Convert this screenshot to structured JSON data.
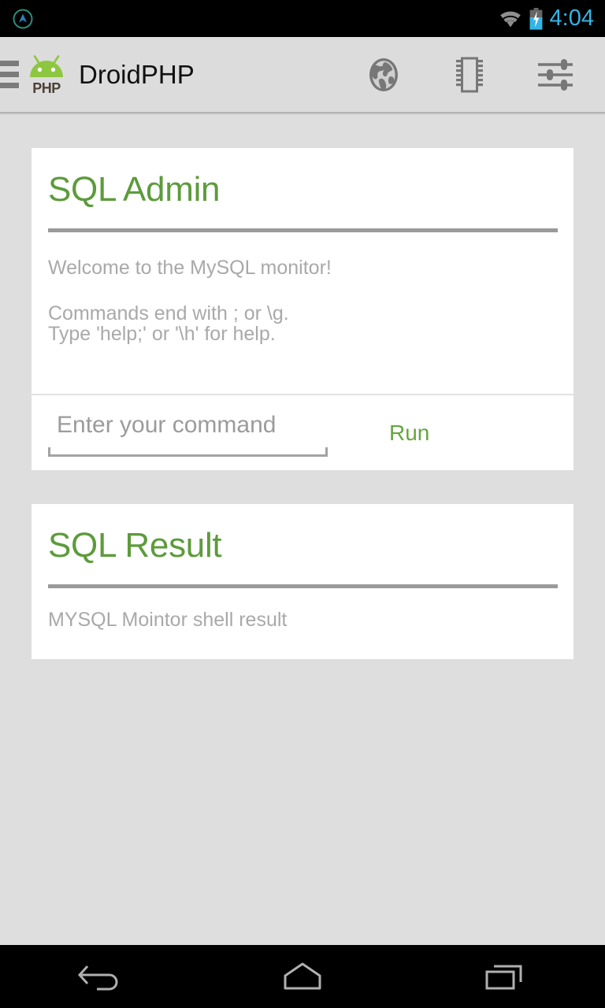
{
  "status_bar": {
    "notification_icon": "circle-arrow-up-icon",
    "wifi_icon": "wifi-icon",
    "battery_icon": "battery-charging-icon",
    "time": "4:04",
    "time_color": "#33b5e5",
    "background": "#000000"
  },
  "app_bar": {
    "menu_icon": "hamburger-menu-icon",
    "logo_icon": "android-php-logo-icon",
    "title": "DroidPHP",
    "background": "#dcdcdc",
    "actions": [
      {
        "name": "globe-icon",
        "label": "Browser"
      },
      {
        "name": "chip-icon",
        "label": "Server"
      },
      {
        "name": "sliders-icon",
        "label": "Settings"
      }
    ]
  },
  "main": {
    "background": "#dedede",
    "accent_green": "#5d9b3c",
    "muted_text": "#a9a9a9",
    "cards": [
      {
        "id": "sql-admin",
        "title": "SQL Admin",
        "lines": [
          "Welcome to the MySQL monitor!",
          "Commands end with ; or \\g.",
          "Type 'help;' or '\\h' for help."
        ],
        "input": {
          "placeholder": "Enter your command",
          "value": "",
          "button_label": "Run",
          "button_color": "#66a63f"
        }
      },
      {
        "id": "sql-result",
        "title": "SQL Result",
        "lines": [
          "MYSQL Mointor shell result"
        ]
      }
    ]
  },
  "nav_bar": {
    "background": "#000000",
    "buttons": [
      {
        "name": "back-icon",
        "label": "Back"
      },
      {
        "name": "home-icon",
        "label": "Home"
      },
      {
        "name": "recents-icon",
        "label": "Recent apps"
      }
    ]
  }
}
